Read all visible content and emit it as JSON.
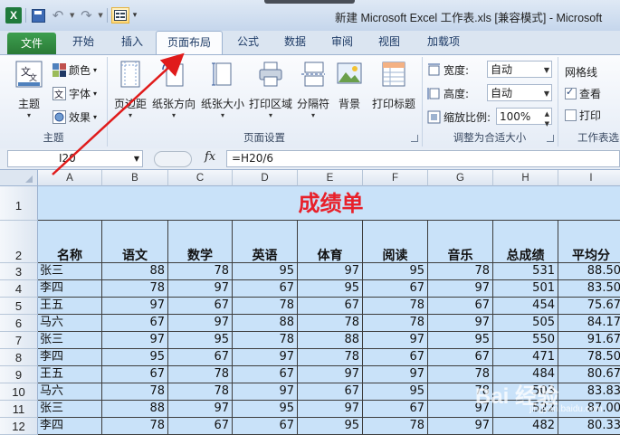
{
  "window": {
    "title": "新建 Microsoft Excel 工作表.xls  [兼容模式]  -  Microsoft",
    "app_icon": "excel-logo"
  },
  "qat": {
    "logo_text": "X"
  },
  "tabs": [
    {
      "label": "文件",
      "key": "file"
    },
    {
      "label": "开始",
      "key": "home"
    },
    {
      "label": "插入",
      "key": "insert"
    },
    {
      "label": "页面布局",
      "key": "page-layout"
    },
    {
      "label": "公式",
      "key": "formulas"
    },
    {
      "label": "数据",
      "key": "data"
    },
    {
      "label": "审阅",
      "key": "review"
    },
    {
      "label": "视图",
      "key": "view"
    },
    {
      "label": "加载项",
      "key": "addins"
    }
  ],
  "active_tab": "页面布局",
  "ribbon": {
    "theme_group": {
      "label": "主题",
      "themes_button": "主题",
      "colors": "颜色",
      "fonts": "字体",
      "effects": "效果"
    },
    "page_setup_group": {
      "label": "页面设置",
      "margins": "页边距",
      "orientation": "纸张方向",
      "size": "纸张大小",
      "print_area": "打印区域",
      "breaks": "分隔符",
      "background": "背景",
      "print_titles": "打印标题"
    },
    "scale_group": {
      "label": "调整为合适大小",
      "width_label": "宽度:",
      "width_value": "自动",
      "height_label": "高度:",
      "height_value": "自动",
      "scale_label": "缩放比例:",
      "scale_value": "100%"
    },
    "sheet_options_group": {
      "label": "工作表选",
      "gridlines": "网格线",
      "view": "查看",
      "print": "打印"
    }
  },
  "formula_bar": {
    "name_box": "I20",
    "fx": "fx",
    "formula": "=H20/6"
  },
  "sheet": {
    "columns": [
      "A",
      "B",
      "C",
      "D",
      "E",
      "F",
      "G",
      "H",
      "I"
    ],
    "title": "成绩单",
    "headers": [
      "名称",
      "语文",
      "数学",
      "英语",
      "体育",
      "阅读",
      "音乐",
      "总成绩",
      "平均分"
    ],
    "rows": [
      {
        "n": "3",
        "cells": [
          "张三",
          "88",
          "78",
          "95",
          "97",
          "95",
          "78",
          "531",
          "88.50"
        ]
      },
      {
        "n": "4",
        "cells": [
          "李四",
          "78",
          "97",
          "67",
          "95",
          "67",
          "97",
          "501",
          "83.50"
        ]
      },
      {
        "n": "5",
        "cells": [
          "王五",
          "97",
          "67",
          "78",
          "67",
          "78",
          "67",
          "454",
          "75.67"
        ]
      },
      {
        "n": "6",
        "cells": [
          "马六",
          "67",
          "97",
          "88",
          "78",
          "78",
          "97",
          "505",
          "84.17"
        ]
      },
      {
        "n": "7",
        "cells": [
          "张三",
          "97",
          "95",
          "78",
          "88",
          "97",
          "95",
          "550",
          "91.67"
        ]
      },
      {
        "n": "8",
        "cells": [
          "李四",
          "95",
          "67",
          "97",
          "78",
          "67",
          "67",
          "471",
          "78.50"
        ]
      },
      {
        "n": "9",
        "cells": [
          "王五",
          "67",
          "78",
          "67",
          "97",
          "97",
          "78",
          "484",
          "80.67"
        ]
      },
      {
        "n": "10",
        "cells": [
          "马六",
          "78",
          "78",
          "97",
          "67",
          "95",
          "78",
          "503",
          "83.83"
        ]
      },
      {
        "n": "11",
        "cells": [
          "张三",
          "88",
          "97",
          "95",
          "97",
          "67",
          "97",
          "522",
          "87.00"
        ]
      },
      {
        "n": "12",
        "cells": [
          "李四",
          "78",
          "67",
          "67",
          "95",
          "78",
          "97",
          "482",
          "80.33"
        ]
      }
    ]
  },
  "watermark": {
    "text": "Bai 经验",
    "url": "jingyan.baidu.com"
  },
  "colors": {
    "accent": "#e8202a",
    "cell_fill": "#c9e2f9",
    "arrow": "#e01b1b"
  }
}
